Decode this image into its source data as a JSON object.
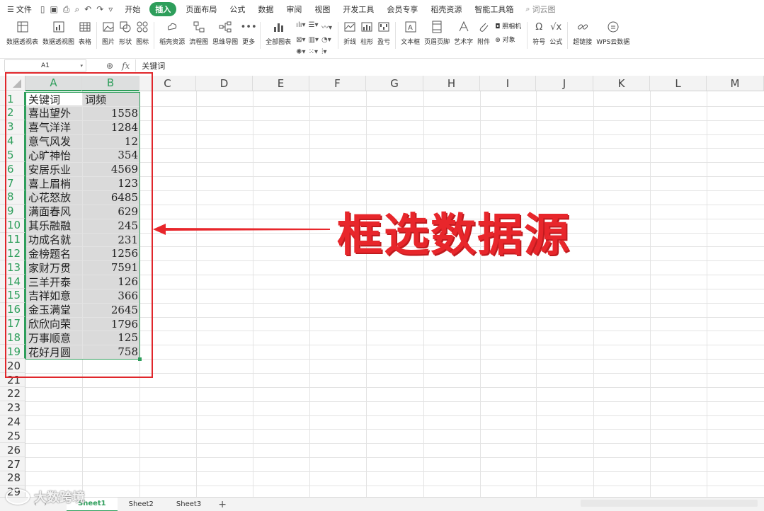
{
  "menu": {
    "file_label": "文件",
    "tabs": [
      "开始",
      "插入",
      "页面布局",
      "公式",
      "数据",
      "审阅",
      "视图",
      "开发工具",
      "会员专享",
      "稻壳资源",
      "智能工具箱"
    ],
    "active_tab": "插入",
    "search_label": "词云图"
  },
  "ribbon": {
    "pivot_table": "数据透视表",
    "pivot_chart": "数据透视图",
    "table": "表格",
    "picture": "图片",
    "shape": "形状",
    "icon": "图标",
    "docer_resources": "稻壳资源",
    "flowchart": "流程图",
    "mindmap": "思维导图",
    "more": "更多",
    "all_charts": "全部图表",
    "sparkline_line": "折线",
    "sparkline_column": "柱形",
    "sparkline_winloss": "盈亏",
    "textbox": "文本框",
    "header_footer": "页眉页脚",
    "wordart": "艺术字",
    "attachment": "附件",
    "camera": "照相机",
    "object": "对象",
    "symbol": "符号",
    "formula": "公式",
    "hyperlink": "超链接",
    "wps_cloud_data": "WPS云数据"
  },
  "formula_bar": {
    "name_box": "A1",
    "fx_label": "fx",
    "content": "关键词"
  },
  "columns": [
    "A",
    "B",
    "C",
    "D",
    "E",
    "F",
    "G",
    "H",
    "I",
    "J",
    "K",
    "L",
    "M"
  ],
  "rows": [
    "1",
    "2",
    "3",
    "4",
    "5",
    "6",
    "7",
    "8",
    "9",
    "10",
    "11",
    "12",
    "13",
    "14",
    "15",
    "16",
    "17",
    "18",
    "19",
    "20",
    "21",
    "22",
    "23",
    "24",
    "25",
    "26",
    "27",
    "28",
    "29"
  ],
  "table": {
    "headers": [
      "关键词",
      "词频"
    ],
    "data": [
      [
        "喜出望外",
        "1558"
      ],
      [
        "喜气洋洋",
        "1284"
      ],
      [
        "意气风发",
        "12"
      ],
      [
        "心旷神怡",
        "354"
      ],
      [
        "安居乐业",
        "4569"
      ],
      [
        "喜上眉梢",
        "123"
      ],
      [
        "心花怒放",
        "6485"
      ],
      [
        "满面春风",
        "629"
      ],
      [
        "其乐融融",
        "245"
      ],
      [
        "功成名就",
        "231"
      ],
      [
        "金榜题名",
        "1256"
      ],
      [
        "家财万贯",
        "7591"
      ],
      [
        "三羊开泰",
        "126"
      ],
      [
        "吉祥如意",
        "366"
      ],
      [
        "金玉满堂",
        "2645"
      ],
      [
        "欣欣向荣",
        "1796"
      ],
      [
        "万事顺意",
        "125"
      ],
      [
        "花好月圆",
        "758"
      ]
    ]
  },
  "annotation": "框选数据源",
  "sheets": [
    "Sheet1",
    "Sheet2",
    "Sheet3"
  ],
  "active_sheet": "Sheet1",
  "watermark": "大数跨境",
  "colors": {
    "accent": "#2e9e5b",
    "annotation_red": "#e8262b"
  }
}
